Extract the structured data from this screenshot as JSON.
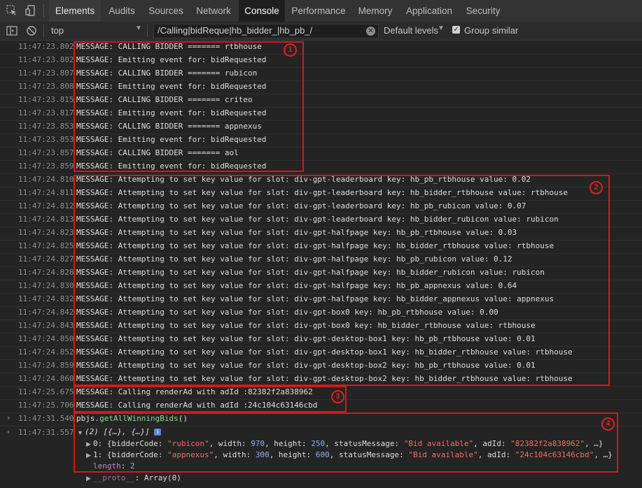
{
  "tabs": [
    "Elements",
    "Audits",
    "Sources",
    "Network",
    "Console",
    "Performance",
    "Memory",
    "Application",
    "Security"
  ],
  "toolbar": {
    "context": "top",
    "filter_value": "/Calling|bidReque|hb_bidder_|hb_pb_/",
    "levels": "Default levels",
    "group_similar": "Group similar",
    "group_similar_checked": true
  },
  "logs": [
    {
      "ts": "11:47:23.802",
      "msg": "MESSAGE: CALLING BIDDER ======= rtbhouse"
    },
    {
      "ts": "11:47:23.802",
      "msg": "MESSAGE: Emitting event for: bidRequested"
    },
    {
      "ts": "11:47:23.807",
      "msg": "MESSAGE: CALLING BIDDER ======= rubicon"
    },
    {
      "ts": "11:47:23.808",
      "msg": "MESSAGE: Emitting event for: bidRequested"
    },
    {
      "ts": "11:47:23.815",
      "msg": "MESSAGE: CALLING BIDDER ======= criteo"
    },
    {
      "ts": "11:47:23.817",
      "msg": "MESSAGE: Emitting event for: bidRequested"
    },
    {
      "ts": "11:47:23.853",
      "msg": "MESSAGE: CALLING BIDDER ======= appnexus"
    },
    {
      "ts": "11:47:23.853",
      "msg": "MESSAGE: Emitting event for: bidRequested"
    },
    {
      "ts": "11:47:23.857",
      "msg": "MESSAGE: CALLING BIDDER ======= aol"
    },
    {
      "ts": "11:47:23.859",
      "msg": "MESSAGE: Emitting event for: bidRequested"
    },
    {
      "ts": "11:47:24.810",
      "msg": "MESSAGE: Attempting to set key value for slot: div-gpt-leaderboard key: hb_pb_rtbhouse value: 0.02"
    },
    {
      "ts": "11:47:24.811",
      "msg": "MESSAGE: Attempting to set key value for slot: div-gpt-leaderboard key: hb_bidder_rtbhouse value: rtbhouse"
    },
    {
      "ts": "11:47:24.812",
      "msg": "MESSAGE: Attempting to set key value for slot: div-gpt-leaderboard key: hb_pb_rubicon value: 0.07"
    },
    {
      "ts": "11:47:24.813",
      "msg": "MESSAGE: Attempting to set key value for slot: div-gpt-leaderboard key: hb_bidder_rubicon value: rubicon"
    },
    {
      "ts": "11:47:24.823",
      "msg": "MESSAGE: Attempting to set key value for slot: div-gpt-halfpage key: hb_pb_rtbhouse value: 0.03"
    },
    {
      "ts": "11:47:24.825",
      "msg": "MESSAGE: Attempting to set key value for slot: div-gpt-halfpage key: hb_bidder_rtbhouse value: rtbhouse"
    },
    {
      "ts": "11:47:24.827",
      "msg": "MESSAGE: Attempting to set key value for slot: div-gpt-halfpage key: hb_pb_rubicon value: 0.12"
    },
    {
      "ts": "11:47:24.828",
      "msg": "MESSAGE: Attempting to set key value for slot: div-gpt-halfpage key: hb_bidder_rubicon value: rubicon"
    },
    {
      "ts": "11:47:24.830",
      "msg": "MESSAGE: Attempting to set key value for slot: div-gpt-halfpage key: hb_pb_appnexus value: 0.64"
    },
    {
      "ts": "11:47:24.832",
      "msg": "MESSAGE: Attempting to set key value for slot: div-gpt-halfpage key: hb_bidder_appnexus value: appnexus"
    },
    {
      "ts": "11:47:24.842",
      "msg": "MESSAGE: Attempting to set key value for slot: div-gpt-box0 key: hb_pb_rtbhouse value: 0.00"
    },
    {
      "ts": "11:47:24.843",
      "msg": "MESSAGE: Attempting to set key value for slot: div-gpt-box0 key: hb_bidder_rtbhouse value: rtbhouse"
    },
    {
      "ts": "11:47:24.850",
      "msg": "MESSAGE: Attempting to set key value for slot: div-gpt-desktop-box1 key: hb_pb_rtbhouse value: 0.01"
    },
    {
      "ts": "11:47:24.852",
      "msg": "MESSAGE: Attempting to set key value for slot: div-gpt-desktop-box1 key: hb_bidder_rtbhouse value: rtbhouse"
    },
    {
      "ts": "11:47:24.859",
      "msg": "MESSAGE: Attempting to set key value for slot: div-gpt-desktop-box2 key: hb_pb_rtbhouse value: 0.01"
    },
    {
      "ts": "11:47:24.860",
      "msg": "MESSAGE: Attempting to set key value for slot: div-gpt-desktop-box2 key: hb_bidder_rtbhouse value: rtbhouse"
    },
    {
      "ts": "11:47:25.675",
      "msg": "MESSAGE: Calling renderAd with adId :82382f2a838962"
    },
    {
      "ts": "11:47:25.706",
      "msg": "MESSAGE: Calling renderAd with adId :24c104c63146cbd"
    }
  ],
  "command": {
    "ts": "11:47:31.540",
    "obj": "pbjs.",
    "fn": "getAllWinningBids",
    "parens": "()"
  },
  "result": {
    "ts": "11:47:31.557",
    "summary": "(2) [{…}, {…}]",
    "info": "i",
    "items": [
      {
        "index": "0:",
        "bidder_val": "\"rubicon\"",
        "width_val": "970",
        "height_val": "250",
        "status_val": "\"Bid available\"",
        "adid_val": "\"82382f2a838962\""
      },
      {
        "index": "1:",
        "bidder_val": "\"appnexus\"",
        "width_val": "300",
        "height_val": "600",
        "status_val": "\"Bid available\"",
        "adid_val": "\"24c104c63146cbd\""
      }
    ],
    "length_key": "length",
    "length_val": "2",
    "proto_key": "__proto__",
    "proto_val": "Array(0)"
  },
  "labels": {
    "brace_open": " {bidderCode: ",
    "width": ", width: ",
    "height": ", height: ",
    "status": ", statusMessage: ",
    "adid": ", adId: ",
    "tail": ", …}"
  },
  "annotations": [
    "1",
    "2",
    "3",
    "4"
  ],
  "colors": {
    "accent_box": "#d11a1a",
    "background": "#242424"
  }
}
